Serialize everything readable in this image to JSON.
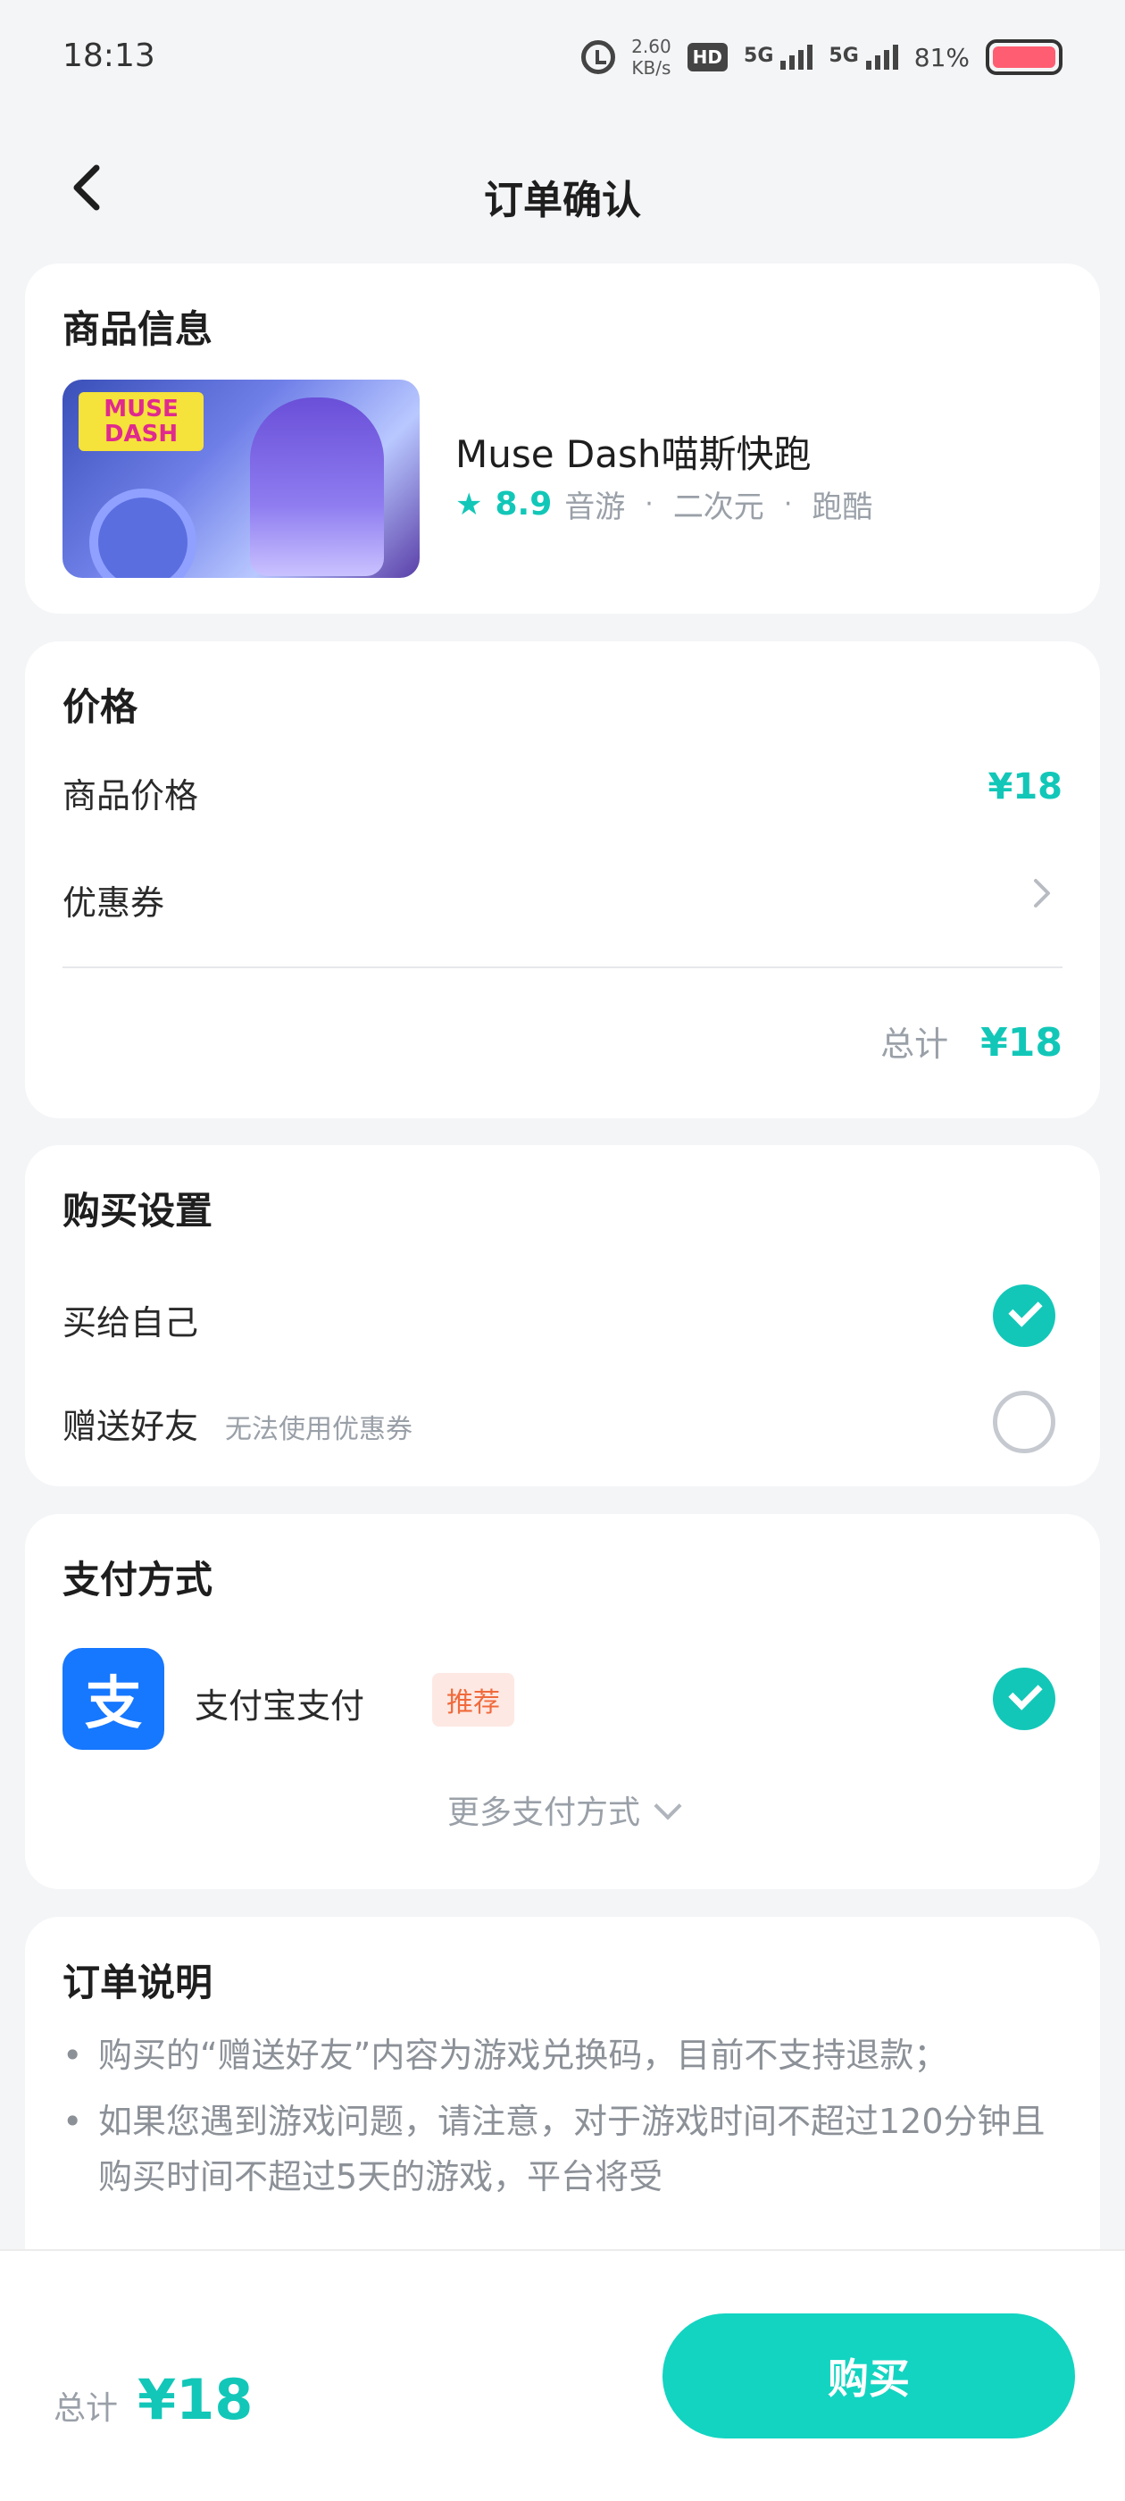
{
  "status_bar": {
    "time": "18:13",
    "net_speed": "2.60",
    "net_speed_unit": "KB/s",
    "hd_label": "HD",
    "signal1_label": "5G",
    "signal2_label": "5G",
    "battery_pct": "81%"
  },
  "header": {
    "title": "订单确认"
  },
  "product": {
    "section_title": "商品信息",
    "name": "Muse Dash喵斯快跑",
    "rating": "8.9",
    "tags": [
      "音游",
      "二次元",
      "跑酷"
    ],
    "thumb_logo_line1": "MUSE",
    "thumb_logo_line2": "DASH"
  },
  "price": {
    "section_title": "价格",
    "product_price_label": "商品价格",
    "product_price_value": "¥18",
    "coupon_label": "优惠券",
    "total_label": "总计",
    "total_value": "¥18"
  },
  "purchase": {
    "section_title": "购买设置",
    "option_self": "买给自己",
    "option_gift": "赠送好友",
    "gift_note": "无法使用优惠券"
  },
  "payment": {
    "section_title": "支付方式",
    "alipay_icon_char": "支",
    "alipay_label": "支付宝支付",
    "recommend_badge": "推荐",
    "more_methods": "更多支付方式"
  },
  "notes": {
    "section_title": "订单说明",
    "items": [
      "购买的“赠送好友”内容为游戏兑换码，目前不支持退款；",
      "如果您遇到游戏问题，请注意，对于游戏时间不超过120分钟且购买时间不超过5天的游戏，平台将受"
    ]
  },
  "bottom_bar": {
    "total_label": "总计",
    "total_value": "¥18",
    "buy_label": "购买"
  },
  "colors": {
    "accent": "#12c7b8",
    "buy_button": "#12d4c1",
    "alipay_blue": "#1677ff",
    "recommend_orange": "#f06a3c"
  }
}
